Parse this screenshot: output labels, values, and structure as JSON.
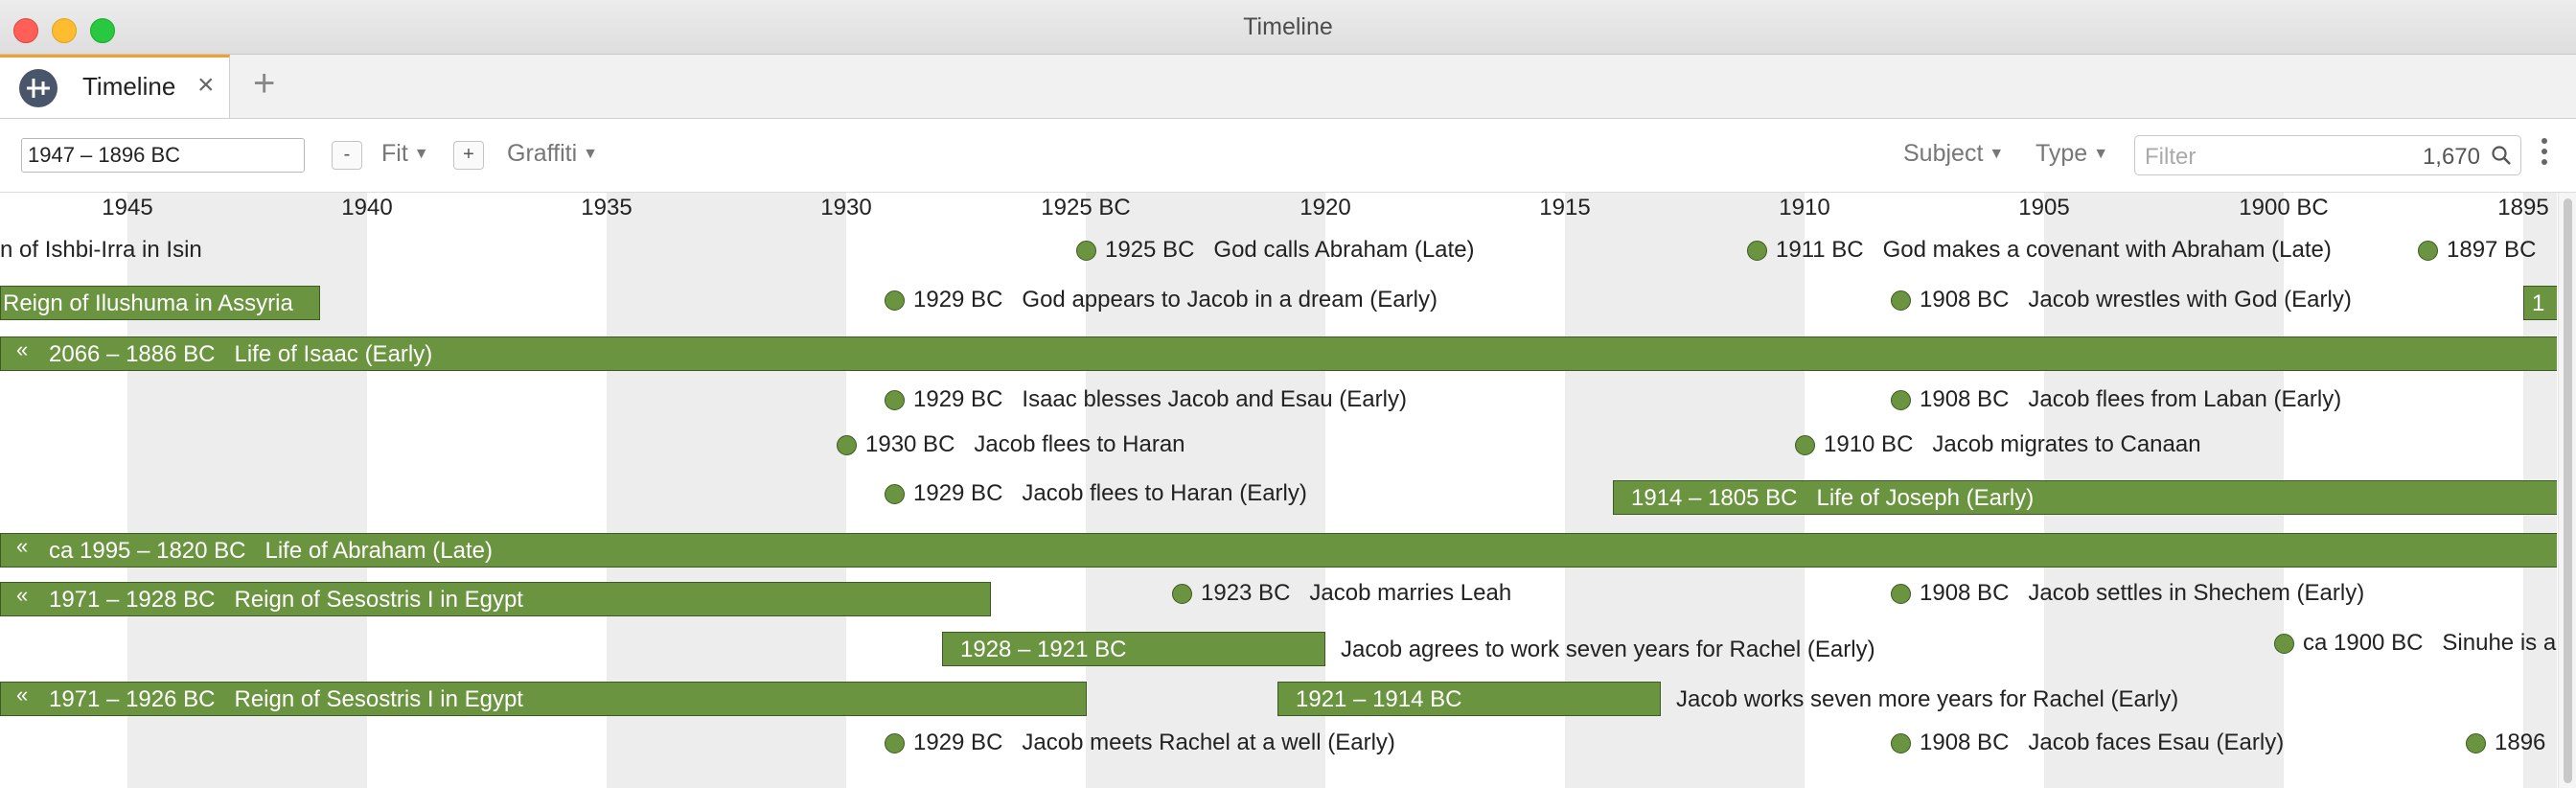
{
  "window": {
    "title": "Timeline"
  },
  "tabs": [
    {
      "label": "Timeline",
      "close": "×"
    }
  ],
  "tab_add": "+",
  "toolbar": {
    "range": "1947 – 1896 BC",
    "zoom_out": "-",
    "fit": "Fit",
    "zoom_in": "+",
    "graffiti": "Graffiti",
    "subject": "Subject",
    "type": "Type",
    "filter_placeholder": "Filter",
    "count": "1,670"
  },
  "colors": {
    "event": "#6b9440",
    "band": "#ededed",
    "tab_accent": "#f0a030"
  },
  "axis": {
    "ticks": [
      "1945",
      "1940",
      "1935",
      "1930",
      "1925 BC",
      "1920",
      "1915",
      "1910",
      "1905",
      "1900 BC",
      "1895"
    ]
  },
  "events": [
    {
      "date": "",
      "title": "n of Ishbi-Irra in Isin"
    },
    {
      "date": "1925 BC",
      "title": "God calls Abraham (Late)"
    },
    {
      "date": "1911 BC",
      "title": "God makes a covenant with Abraham (Late)"
    },
    {
      "date": "1897 BC",
      "title": ""
    },
    {
      "date": "1929 BC",
      "title": "God appears to Jacob in a dream (Early)"
    },
    {
      "date": "1908 BC",
      "title": "Jacob wrestles with God (Early)"
    },
    {
      "date": "1929 BC",
      "title": "Isaac blesses Jacob and Esau (Early)"
    },
    {
      "date": "1908 BC",
      "title": "Jacob flees from Laban (Early)"
    },
    {
      "date": "1930 BC",
      "title": "Jacob flees to Haran"
    },
    {
      "date": "1910 BC",
      "title": "Jacob migrates to Canaan"
    },
    {
      "date": "1929 BC",
      "title": "Jacob flees to Haran (Early)"
    },
    {
      "date": "1923 BC",
      "title": "Jacob marries Leah"
    },
    {
      "date": "1908 BC",
      "title": "Jacob settles in Shechem (Early)"
    },
    {
      "date": "ca 1900 BC",
      "title": "Sinuhe is a"
    },
    {
      "date": "1929 BC",
      "title": "Jacob meets Rachel at a well (Early)"
    },
    {
      "date": "1908 BC",
      "title": "Jacob faces Esau (Early)"
    },
    {
      "date": "1896",
      "title": ""
    }
  ],
  "bars": [
    {
      "date": "",
      "title": "Reign of Ilushuma in Assyria",
      "chevron": ""
    },
    {
      "date": "",
      "title": "1",
      "chevron": ""
    },
    {
      "date": "2066 – 1886 BC",
      "title": "Life of Isaac (Early)",
      "chevron": "«"
    },
    {
      "date": "1914 – 1805 BC",
      "title": "Life of Joseph (Early)",
      "chevron": ""
    },
    {
      "date": "ca 1995 – 1820 BC",
      "title": "Life of Abraham (Late)",
      "chevron": "«"
    },
    {
      "date": "1971 – 1928 BC",
      "title": "Reign of Sesostris I in Egypt",
      "chevron": "«"
    },
    {
      "date": "1928 – 1921 BC",
      "title": "Jacob agrees to work seven years for Rachel (Early)",
      "chevron": ""
    },
    {
      "date": "1971 – 1926 BC",
      "title": "Reign of Sesostris I in Egypt",
      "chevron": "«"
    },
    {
      "date": "1921 – 1914 BC",
      "title": "Jacob works seven more years for Rachel (Early)",
      "chevron": ""
    }
  ]
}
